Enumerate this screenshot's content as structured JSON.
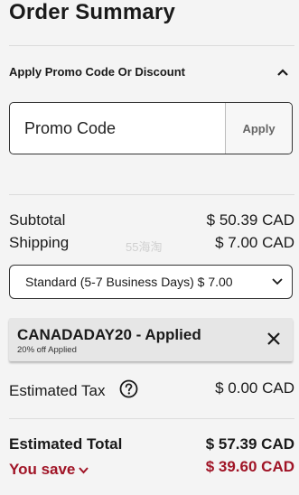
{
  "header": {
    "title": "Order Summary"
  },
  "promo": {
    "section_label": "Apply Promo Code Or Discount",
    "placeholder": "Promo Code",
    "apply_label": "Apply"
  },
  "summary": {
    "subtotal_label": "Subtotal",
    "subtotal_value": "$ 50.39 CAD",
    "shipping_label": "Shipping",
    "shipping_value": "$ 7.00 CAD"
  },
  "watermark": "55海淘",
  "shipping_select": {
    "selected": "Standard (5-7 Business Days) $ 7.00"
  },
  "coupon": {
    "code": "CANADADAY20 - Applied",
    "detail": "20% off Applied"
  },
  "tax": {
    "label": "Estimated Tax",
    "value": "$ 0.00 CAD"
  },
  "total": {
    "label": "Estimated Total",
    "value": "$ 57.39 CAD",
    "save_label": "You save",
    "save_value": "$ 39.60 CAD"
  },
  "colors": {
    "accent": "#a01426",
    "background": "#f4f4f4"
  },
  "icons": [
    "chevron-up-icon",
    "chevron-down-icon",
    "close-icon",
    "help-icon"
  ]
}
